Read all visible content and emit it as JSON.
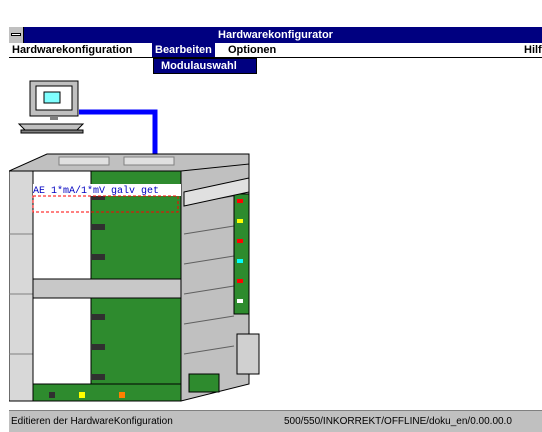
{
  "window": {
    "title": "Hardwarekonfigurator"
  },
  "menu": {
    "items": [
      {
        "label": "Hardwarekonfiguration"
      },
      {
        "label": "Bearbeiten"
      },
      {
        "label": "Optionen"
      },
      {
        "label": "Hilf"
      }
    ],
    "active_index": 1,
    "dropdown": {
      "items": [
        {
          "label": "Modulauswahl"
        }
      ]
    }
  },
  "canvas": {
    "module_label": "AE 1*mA/1*mV galv get",
    "icons": [
      "computer-icon",
      "cable",
      "rack"
    ]
  },
  "status": {
    "left": "Editieren der HardwareKonfiguration",
    "right": "500/550/INKORREKT/OFFLINE/doku_en/0.00.00.0"
  },
  "colors": {
    "title_bar": "#000080",
    "cable": "#0000ff",
    "rack_pcb": "#008000",
    "rack_frame": "#c0c0c0"
  }
}
